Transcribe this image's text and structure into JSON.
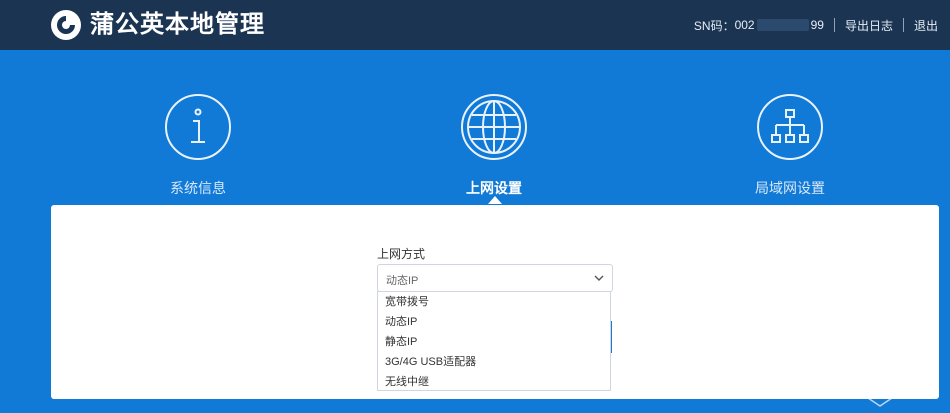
{
  "header": {
    "title": "蒲公英本地管理",
    "sn_label": "SN码：",
    "sn_prefix": "002",
    "sn_suffix": "99",
    "export_log": "导出日志",
    "logout": "退出"
  },
  "nav": {
    "items": [
      {
        "label": "系统信息",
        "icon": "info-icon"
      },
      {
        "label": "上网设置",
        "icon": "globe-icon",
        "active": true
      },
      {
        "label": "局域网设置",
        "icon": "network-icon"
      }
    ]
  },
  "form": {
    "connection_label": "上网方式",
    "connection_value": "动态IP",
    "options": [
      "宽带拨号",
      "动态IP",
      "静态IP",
      "3G/4G USB适配器",
      "无线中继"
    ]
  },
  "colors": {
    "header_bg": "#1b3452",
    "main_bg": "#1179d6",
    "panel_bg": "#ffffff"
  }
}
